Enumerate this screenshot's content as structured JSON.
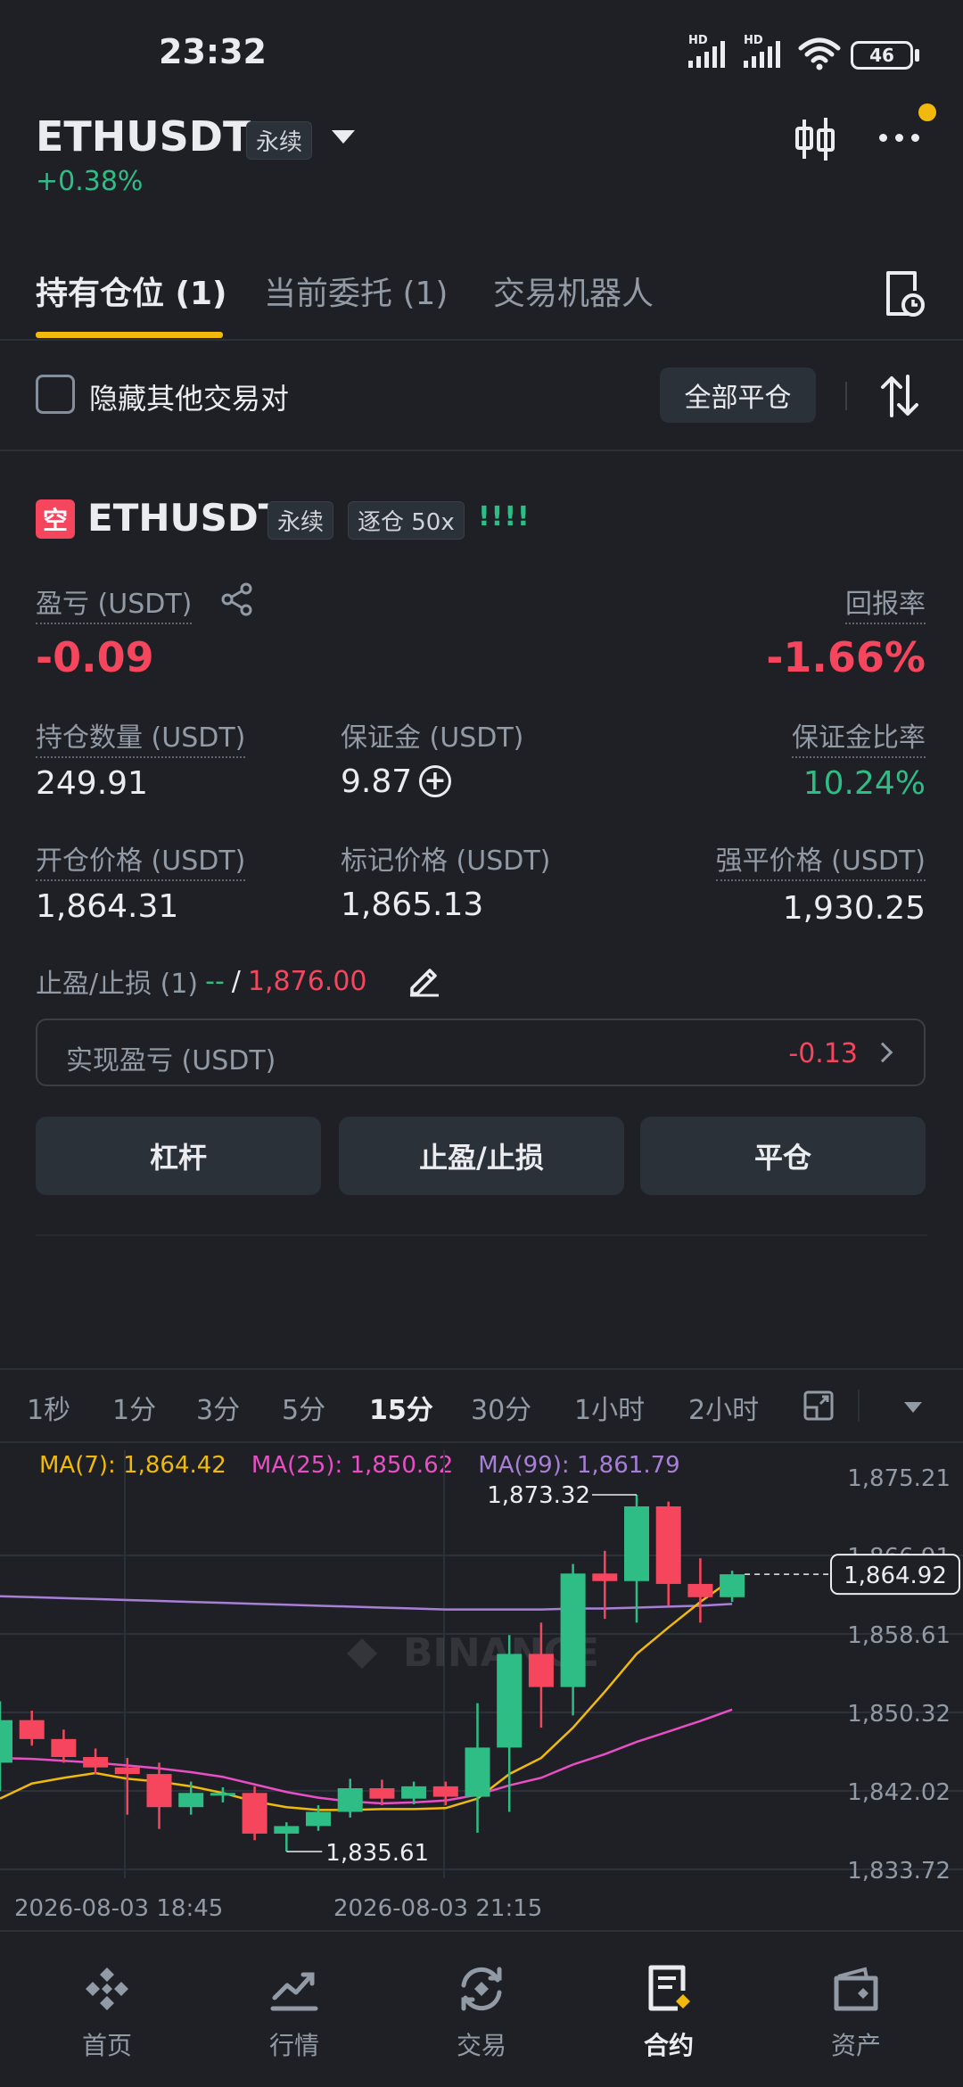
{
  "status_bar": {
    "time": "23:32",
    "battery": "46",
    "hd1": "HD",
    "hd2": "HD"
  },
  "header": {
    "symbol": "ETHUSDT",
    "contract_tag": "永续",
    "change": "+0.38%"
  },
  "tabs": [
    {
      "label": "持有仓位 (1)",
      "active": true
    },
    {
      "label": "当前委托 (1)",
      "active": false
    },
    {
      "label": "交易机器人",
      "active": false
    }
  ],
  "filter": {
    "hide_others_label": "隐藏其他交易对",
    "close_all_label": "全部平仓"
  },
  "position": {
    "side_badge": "空",
    "symbol": "ETHUSDT",
    "contract_tag": "永续",
    "margin_mode_tag": "逐仓 50x",
    "strength_bars": "!!!!",
    "pnl_label": "盈亏 (USDT)",
    "pnl_value": "-0.09",
    "roe_label": "回报率",
    "roe_value": "-1.66%",
    "size_label": "持仓数量 (USDT)",
    "size_value": "249.91",
    "margin_label": "保证金 (USDT)",
    "margin_value": "9.87",
    "margin_ratio_label": "保证金比率",
    "margin_ratio_value": "10.24%",
    "entry_label": "开仓价格 (USDT)",
    "entry_value": "1,864.31",
    "mark_label": "标记价格 (USDT)",
    "mark_value": "1,865.13",
    "liq_label": "强平价格 (USDT)",
    "liq_value": "1,930.25",
    "tpsl_label": "止盈/止损 (1)",
    "tp_value": "--",
    "tpsl_sep": "/",
    "sl_value": "1,876.00",
    "realized_label": "实现盈亏 (USDT)",
    "realized_value": "-0.13",
    "buttons": {
      "leverage": "杠杆",
      "tpsl": "止盈/止损",
      "close": "平仓"
    }
  },
  "chart": {
    "intervals": [
      "1秒",
      "1分",
      "3分",
      "5分",
      "15分",
      "30分",
      "1小时",
      "2小时"
    ],
    "active_interval": "15分",
    "ma7": "MA(7): 1,864.42",
    "ma25": "MA(25): 1,850.62",
    "ma99": "MA(99): 1,861.79",
    "colors": {
      "up": "#2ebd85",
      "down": "#f6465d",
      "ma7": "#f0b90b",
      "ma25": "#e84fc5",
      "ma99": "#a77fd6"
    },
    "watermark": "BINANCE"
  },
  "chart_data": {
    "type": "candlestick",
    "y_ticks": [
      "1,875.21",
      "1,866.91",
      "1,858.61",
      "1,850.32",
      "1,842.02",
      "1,833.72"
    ],
    "x_ticks": [
      "2026-08-03 18:45",
      "2026-08-03 21:15"
    ],
    "ylim": [
      1833.72,
      1875.21
    ],
    "last_price": "1,864.92",
    "high_label": "1,873.32",
    "low_label": "1,835.61",
    "candles": [
      {
        "o": 1845.0,
        "h": 1851.5,
        "l": 1842.0,
        "c": 1849.5
      },
      {
        "o": 1849.5,
        "h": 1850.5,
        "l": 1846.8,
        "c": 1847.5
      },
      {
        "o": 1847.5,
        "h": 1848.5,
        "l": 1845.0,
        "c": 1845.6
      },
      {
        "o": 1845.6,
        "h": 1846.5,
        "l": 1843.8,
        "c": 1844.5
      },
      {
        "o": 1844.5,
        "h": 1845.5,
        "l": 1839.5,
        "c": 1843.8
      },
      {
        "o": 1843.8,
        "h": 1845.0,
        "l": 1838.0,
        "c": 1840.3
      },
      {
        "o": 1840.3,
        "h": 1843.0,
        "l": 1839.5,
        "c": 1841.8
      },
      {
        "o": 1841.8,
        "h": 1842.4,
        "l": 1840.8,
        "c": 1841.8
      },
      {
        "o": 1841.8,
        "h": 1842.5,
        "l": 1836.8,
        "c": 1837.5
      },
      {
        "o": 1837.5,
        "h": 1838.7,
        "l": 1835.61,
        "c": 1838.3
      },
      {
        "o": 1838.3,
        "h": 1840.5,
        "l": 1837.8,
        "c": 1839.8
      },
      {
        "o": 1839.8,
        "h": 1843.3,
        "l": 1839.2,
        "c": 1842.3
      },
      {
        "o": 1842.3,
        "h": 1843.2,
        "l": 1840.5,
        "c": 1841.2
      },
      {
        "o": 1841.2,
        "h": 1843.0,
        "l": 1840.6,
        "c": 1842.5
      },
      {
        "o": 1842.5,
        "h": 1843.0,
        "l": 1840.5,
        "c": 1841.4
      },
      {
        "o": 1841.4,
        "h": 1851.3,
        "l": 1837.6,
        "c": 1846.6
      },
      {
        "o": 1846.6,
        "h": 1858.5,
        "l": 1839.8,
        "c": 1856.5
      },
      {
        "o": 1856.5,
        "h": 1859.8,
        "l": 1848.7,
        "c": 1853.0
      },
      {
        "o": 1853.0,
        "h": 1866.0,
        "l": 1850.0,
        "c": 1865.0
      },
      {
        "o": 1865.0,
        "h": 1867.4,
        "l": 1860.2,
        "c": 1864.2
      },
      {
        "o": 1864.2,
        "h": 1873.32,
        "l": 1859.8,
        "c": 1872.1
      },
      {
        "o": 1872.1,
        "h": 1872.6,
        "l": 1861.6,
        "c": 1863.9
      },
      {
        "o": 1863.9,
        "h": 1866.6,
        "l": 1859.8,
        "c": 1862.5
      },
      {
        "o": 1862.5,
        "h": 1865.3,
        "l": 1862.0,
        "c": 1864.92
      }
    ],
    "ma7": [
      1841.2,
      1842.8,
      1843.4,
      1843.9,
      1843.3,
      1843.0,
      1842.5,
      1841.8,
      1840.9,
      1840.3,
      1840.0,
      1840.0,
      1840.1,
      1840.1,
      1840.2,
      1841.2,
      1843.8,
      1845.5,
      1848.7,
      1852.5,
      1856.5,
      1859.3,
      1862.0,
      1864.42
    ],
    "ma25": [
      1845.5,
      1845.4,
      1845.2,
      1845.0,
      1844.7,
      1844.4,
      1844.0,
      1843.5,
      1842.7,
      1841.9,
      1841.3,
      1840.9,
      1840.7,
      1840.8,
      1841.0,
      1841.6,
      1842.6,
      1843.4,
      1844.8,
      1845.9,
      1847.2,
      1848.3,
      1849.4,
      1850.62
    ]
  },
  "ma99_series": [
    1862.6,
    1862.5,
    1862.4,
    1862.3,
    1862.2,
    1862.1,
    1862.0,
    1861.9,
    1861.8,
    1861.7,
    1861.6,
    1861.5,
    1861.4,
    1861.3,
    1861.2,
    1861.2,
    1861.2,
    1861.2,
    1861.3,
    1861.3,
    1861.4,
    1861.5,
    1861.6,
    1861.79
  ],
  "bottom_nav": [
    {
      "label": "首页",
      "icon": "home-diamond-icon"
    },
    {
      "label": "行情",
      "icon": "market-trend-icon"
    },
    {
      "label": "交易",
      "icon": "trade-exchange-icon"
    },
    {
      "label": "合约",
      "icon": "futures-contract-icon",
      "active": true
    },
    {
      "label": "资产",
      "icon": "wallet-icon"
    }
  ]
}
